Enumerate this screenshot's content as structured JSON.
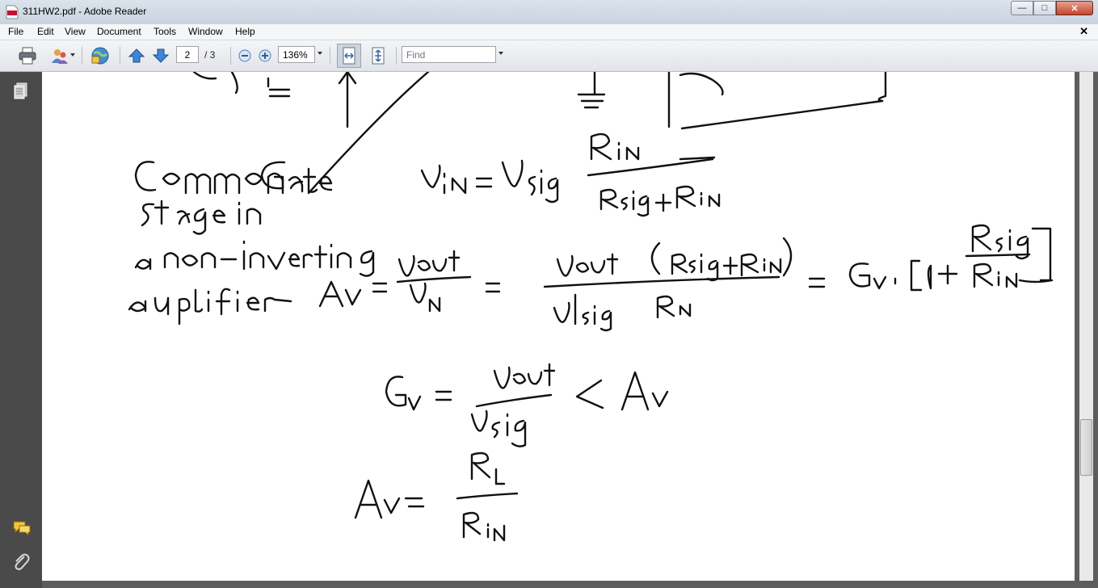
{
  "window": {
    "title": "311HW2.pdf - Adobe Reader",
    "controls": {
      "minimize": "—",
      "maximize": "□",
      "close": "✕"
    }
  },
  "menubar": {
    "items": [
      {
        "label": "File"
      },
      {
        "label": "Edit"
      },
      {
        "label": "View"
      },
      {
        "label": "Document"
      },
      {
        "label": "Tools"
      },
      {
        "label": "Window"
      },
      {
        "label": "Help"
      }
    ],
    "doc_close": "✕"
  },
  "toolbar": {
    "current_page": "2",
    "total_pages": "/ 3",
    "zoom": "136%",
    "find_placeholder": "Find"
  },
  "icons": {
    "print": "printer-icon",
    "collaborate": "collaborate-icon",
    "secure": "globe-icon",
    "prev": "arrow-up-icon",
    "next": "arrow-down-icon",
    "zoom_out": "zoom-out-icon",
    "zoom_in": "zoom-in-icon",
    "fit_width": "fit-width-icon",
    "fit_page": "fit-page-icon",
    "pages": "pages-icon",
    "comments": "comments-icon",
    "attachments": "paperclip-icon"
  }
}
